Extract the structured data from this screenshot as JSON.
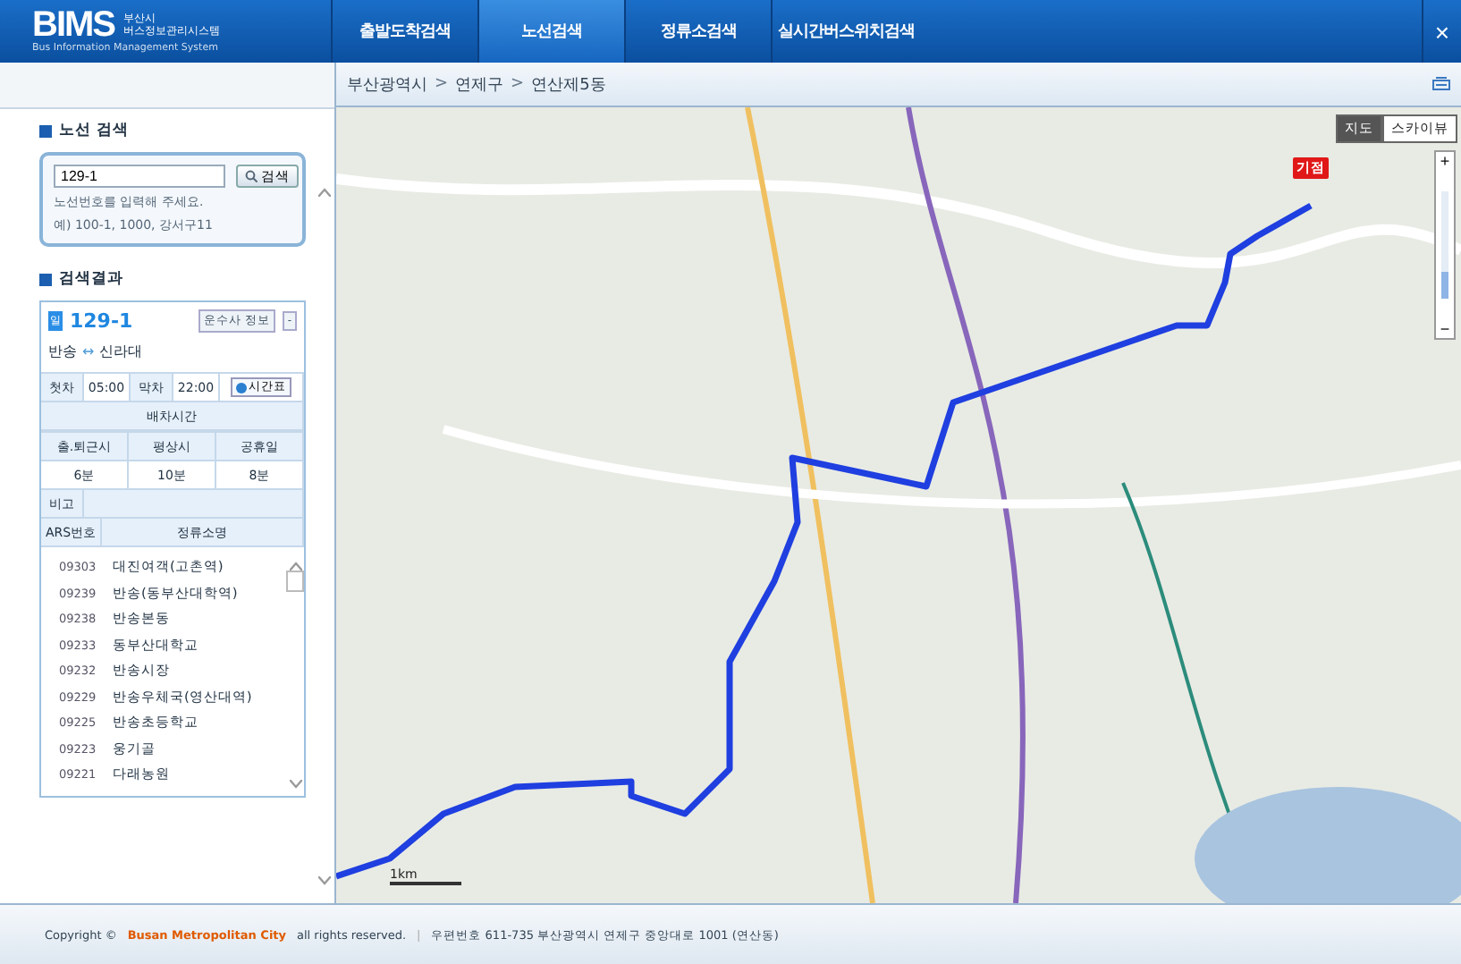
{
  "header": {
    "logo": "BIMS",
    "logo_sub_1": "부산시",
    "logo_sub_2": "버스정보관리시스템",
    "logo_tagline": "Bus Information Management System",
    "tabs": [
      {
        "label": "출발도착검색",
        "selected": false
      },
      {
        "label": "노선검색",
        "selected": true
      },
      {
        "label": "정류소검색",
        "selected": false
      },
      {
        "label": "실시간버스위치검색",
        "selected": false
      }
    ],
    "close": "×"
  },
  "breadcrumb": [
    "부산광역시",
    "연제구",
    "연산제5동"
  ],
  "breadcrumb_sep": ">",
  "route_search": {
    "title": "노선 검색",
    "value": "129-1",
    "button": "검색",
    "hint_1": "노선번호를 입력해 주세요.",
    "hint_2": "예) 100-1, 1000, 강서구11"
  },
  "results": {
    "title": "검색결과",
    "route_badge": "일",
    "route": "129-1",
    "operator_button": "운수사 정보",
    "collapse_button": "-",
    "from": "반송",
    "arrow": "↔",
    "to": "신라대",
    "first_label": "첫차",
    "first_time": "05:00",
    "last_label": "막차",
    "last_time": "22:00",
    "timetable_button": "시간표",
    "interval_title": "배차시간",
    "interval_columns": [
      "출.퇴근시",
      "평상시",
      "공휴일"
    ],
    "intervals": [
      "6분",
      "10분",
      "8분"
    ],
    "note_label": "비고",
    "stop_columns": [
      "ARS번호",
      "정류소명"
    ],
    "stops": [
      {
        "ars": "09303",
        "name": "대진여객(고촌역)"
      },
      {
        "ars": "09239",
        "name": "반송(동부산대학역)"
      },
      {
        "ars": "09238",
        "name": "반송본동"
      },
      {
        "ars": "09233",
        "name": "동부산대학교"
      },
      {
        "ars": "09232",
        "name": "반송시장"
      },
      {
        "ars": "09229",
        "name": "반송우체국(영산대역)"
      },
      {
        "ars": "09225",
        "name": "반송초등학교"
      },
      {
        "ars": "09223",
        "name": "웅기골"
      },
      {
        "ars": "09221",
        "name": "다래농원"
      }
    ]
  },
  "map": {
    "view_toggle": [
      {
        "label": "지도",
        "selected": true
      },
      {
        "label": "스카이뷰",
        "selected": false
      }
    ],
    "zoom_in": "+",
    "zoom_out": "−",
    "zoom_slider": {
      "level": 0.25
    },
    "start_marker": "기점",
    "scale": "1km"
  },
  "footer": {
    "copyright_prefix": "Copyright ©",
    "org": "Busan Metropolitan City",
    "copyright_suffix": "all rights reserved.",
    "divider": "|",
    "address": "우편번호 611-735 부산광역시 연제구 중앙대로 1001 (연산동)"
  }
}
